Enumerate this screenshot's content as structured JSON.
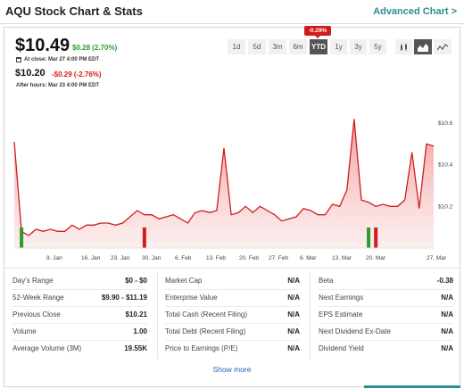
{
  "header": {
    "title": "AQU Stock Chart & Stats",
    "advanced_link": "Advanced Chart >"
  },
  "quote": {
    "price": "$10.49",
    "change": "$0.28 (2.70%)",
    "close_label": "At close: Mar 27 4:00 PM EDT",
    "after_price": "$10.20",
    "after_change": "-$0.29 (-2.76%)",
    "after_label": "After hours: Mar 23 4:00 PM EDT"
  },
  "ranges": {
    "items": [
      "1d",
      "5d",
      "3m",
      "6m",
      "YTD",
      "1y",
      "3y",
      "5y"
    ],
    "selected": "YTD",
    "selected_tooltip": "-0.29%"
  },
  "chart_types": [
    "candlestick-icon",
    "area-chart-icon",
    "line-chart-icon"
  ],
  "chart_data": {
    "type": "area",
    "x": [
      "Jan 2",
      "Jan 3",
      "Jan 4",
      "Jan 5",
      "Jan 6",
      "Jan 9",
      "Jan 10",
      "Jan 11",
      "Jan 12",
      "Jan 13",
      "Jan 17",
      "Jan 18",
      "Jan 19",
      "Jan 20",
      "Jan 23",
      "Jan 24",
      "Jan 25",
      "Jan 26",
      "Jan 27",
      "Jan 30",
      "Jan 31",
      "Feb 1",
      "Feb 2",
      "Feb 3",
      "Feb 6",
      "Feb 7",
      "Feb 8",
      "Feb 9",
      "Feb 10",
      "Feb 13",
      "Feb 14",
      "Feb 15",
      "Feb 16",
      "Feb 17",
      "Feb 21",
      "Feb 22",
      "Feb 23",
      "Feb 24",
      "Feb 27",
      "Feb 28",
      "Mar 1",
      "Mar 2",
      "Mar 3",
      "Mar 6",
      "Mar 7",
      "Mar 8",
      "Mar 9",
      "Mar 10",
      "Mar 13",
      "Mar 14",
      "Mar 15",
      "Mar 16",
      "Mar 17",
      "Mar 20",
      "Mar 21",
      "Mar 22",
      "Mar 23",
      "Mar 24",
      "Mar 27"
    ],
    "values": [
      10.51,
      10.08,
      10.06,
      10.09,
      10.08,
      10.09,
      10.08,
      10.08,
      10.11,
      10.09,
      10.11,
      10.11,
      10.12,
      10.12,
      10.11,
      10.12,
      10.15,
      10.18,
      10.16,
      10.16,
      10.14,
      10.15,
      10.16,
      10.14,
      10.12,
      10.17,
      10.18,
      10.17,
      10.18,
      10.48,
      10.16,
      10.17,
      10.2,
      10.17,
      10.2,
      10.18,
      10.16,
      10.13,
      10.14,
      10.15,
      10.19,
      10.18,
      10.16,
      10.16,
      10.21,
      10.2,
      10.28,
      10.62,
      10.23,
      10.22,
      10.2,
      10.21,
      10.2,
      10.2,
      10.23,
      10.46,
      10.19,
      10.5,
      10.49
    ],
    "volume_markers": [
      {
        "x": "Jan 3",
        "color": "#2e9b2e"
      },
      {
        "x": "Jan 27",
        "color": "#d11c1c"
      },
      {
        "x": "Mar 14",
        "color": "#2e9b2e"
      },
      {
        "x": "Mar 15",
        "color": "#d11c1c"
      }
    ],
    "y_ticks": [
      10.2,
      10.4,
      10.6
    ],
    "y_tick_labels": [
      "$10.2",
      "$10.4",
      "$10.6"
    ],
    "x_tick_labels": [
      "9. Jan",
      "16. Jan",
      "23. Jan",
      "30. Jan",
      "6. Feb",
      "13. Feb",
      "20. Feb",
      "27. Feb",
      "6. Mar",
      "13. Mar",
      "20. Mar",
      "27. Mar"
    ],
    "ylim": [
      10.0,
      10.72
    ],
    "line_color": "#d11c1c",
    "grid": false
  },
  "stats": {
    "col1": [
      {
        "label": "Day's Range",
        "value": "$0 - $0"
      },
      {
        "label": "52-Week Range",
        "value": "$9.90 - $11.19"
      },
      {
        "label": "Previous Close",
        "value": "$10.21"
      },
      {
        "label": "Volume",
        "value": "1.00"
      },
      {
        "label": "Average Volume (3M)",
        "value": "19.55K"
      }
    ],
    "col2": [
      {
        "label": "Market Cap",
        "value": "N/A"
      },
      {
        "label": "Enterprise Value",
        "value": "N/A"
      },
      {
        "label": "Total Cash (Recent Filing)",
        "value": "N/A"
      },
      {
        "label": "Total Debt (Recent Filing)",
        "value": "N/A"
      },
      {
        "label": "Price to Earnings (P/E)",
        "value": "N/A"
      }
    ],
    "col3": [
      {
        "label": "Beta",
        "value": "-0.38"
      },
      {
        "label": "Next Earnings",
        "value": "N/A"
      },
      {
        "label": "EPS Estimate",
        "value": "N/A"
      },
      {
        "label": "Next Dividend Ex-Date",
        "value": "N/A"
      },
      {
        "label": "Dividend Yield",
        "value": "N/A"
      }
    ]
  },
  "show_more": "Show more"
}
